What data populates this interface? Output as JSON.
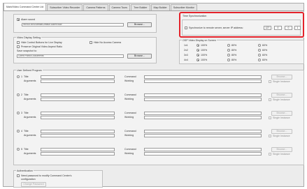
{
  "tabs": [
    {
      "label": "Main/Video Command Center Ltd",
      "active": true
    },
    {
      "label": "Subscriber Video Recorder",
      "active": false
    },
    {
      "label": "Camera Patterns",
      "active": false
    },
    {
      "label": "Camera Tours",
      "active": false
    },
    {
      "label": "Tree Builder",
      "active": false
    },
    {
      "label": "Map Builder",
      "active": false
    },
    {
      "label": "Subscriber Monitor",
      "active": false
    }
  ],
  "alarm_sound": {
    "checkbox_label": "Alarm sound",
    "checked": true,
    "file_path": "WINDOWS\\Media\\Default Alarm.wav",
    "browse_label": "Browse..."
  },
  "time_sync": {
    "title": "Time Synchronization",
    "label": "Synchronize to remote server, server IP address:",
    "checked": false,
    "ip": [
      "127",
      "0",
      "0",
      "1"
    ]
  },
  "video_display": {
    "title": "Video Display Setting",
    "options": [
      {
        "label": "Hide Control Buttons for Live Display",
        "checked": false
      },
      {
        "label": "Hide No Access Camera",
        "checked": false
      },
      {
        "label": "Preserve Original Video Aspect Ratio",
        "checked": false
      }
    ],
    "snapshot_label": "Save snapshot to:",
    "snapshot_path": "Client Patrol Documents",
    "browse_label": "Browse..."
  },
  "osp": {
    "title": "OSP Video Display on Screen",
    "columns": [
      "100%",
      "80%",
      "60%"
    ],
    "rows": [
      {
        "label": "1x1",
        "selected": 0
      },
      {
        "label": "2x2",
        "selected": 0
      },
      {
        "label": "3x3",
        "selected": 0
      },
      {
        "label": "4x4",
        "selected": 0
      }
    ]
  },
  "programs": {
    "title": "User Defined Program",
    "title_label": "Title",
    "arguments_label": "Arguments",
    "command_label": "Command",
    "working_label": "Working",
    "browse_label": "Browse...",
    "single_instance_label": "Single Instance",
    "items": [
      {
        "number": "1"
      },
      {
        "number": "2"
      },
      {
        "number": "3"
      },
      {
        "number": "4"
      },
      {
        "number": "5"
      }
    ]
  },
  "auth": {
    "title": "Authentication",
    "label_line1": "Need password to modify Command Center's",
    "label_line2": "configuration",
    "button_label": "Change Password"
  }
}
